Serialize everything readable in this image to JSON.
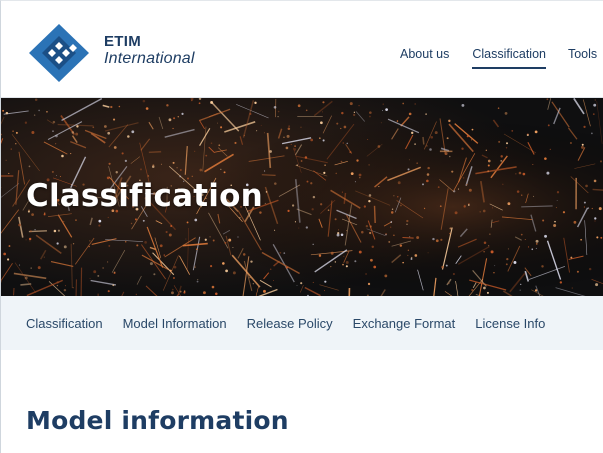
{
  "brand": {
    "name": "ETIM",
    "subtitle": "International",
    "colors": {
      "primary": "#1e3d63",
      "logo_blue": "#2b73b6",
      "logo_dark": "#1b4f86"
    }
  },
  "topnav": {
    "items": [
      {
        "label": "About us"
      },
      {
        "label": "Classification",
        "active": true
      },
      {
        "label": "Tools"
      }
    ]
  },
  "hero": {
    "title": "Classification",
    "image": "night-city-aerial"
  },
  "subnav": {
    "items": [
      {
        "label": "Classification"
      },
      {
        "label": "Model Information"
      },
      {
        "label": "Release Policy"
      },
      {
        "label": "Exchange Format"
      },
      {
        "label": "License Info"
      }
    ]
  },
  "main": {
    "heading": "Model information"
  }
}
